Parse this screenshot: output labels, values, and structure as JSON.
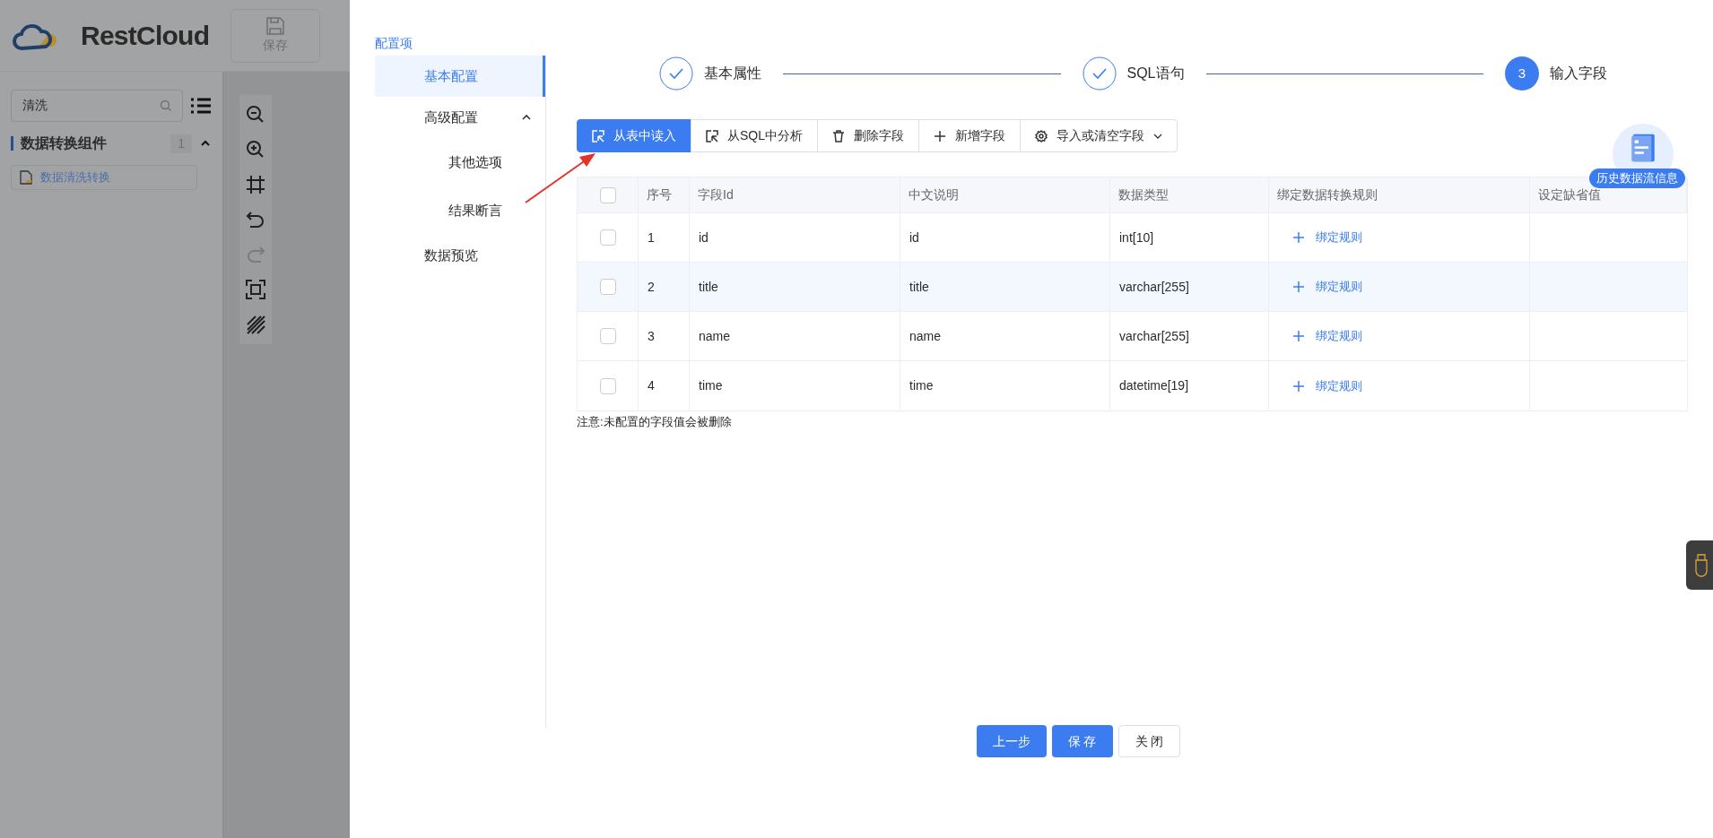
{
  "app": {
    "logo": "RestCloud",
    "toolbar_buttons": [
      {
        "label": "保存"
      }
    ],
    "search": {
      "value": "清洗"
    },
    "category": {
      "title": "数据转换组件",
      "count": "1",
      "expanded": true
    },
    "components": [
      {
        "label": "数据清洗转换"
      }
    ],
    "canvas_tools": [
      {
        "kind": "zoom-out",
        "disabled": false
      },
      {
        "kind": "zoom-in",
        "disabled": false
      },
      {
        "kind": "fit",
        "disabled": false
      },
      {
        "kind": "undo",
        "disabled": false
      },
      {
        "kind": "redo",
        "disabled": true
      },
      {
        "kind": "fullscreen",
        "disabled": false
      },
      {
        "kind": "grid",
        "disabled": false
      }
    ]
  },
  "drawer": {
    "menu_title": "配置项",
    "menu": [
      {
        "label": "基本配置",
        "selected": true
      },
      {
        "label": "高级配置",
        "selected": false,
        "expanded": true,
        "children": [
          {
            "label": "其他选项",
            "selected": false
          },
          {
            "label": "结果断言",
            "selected": false
          }
        ]
      },
      {
        "label": "数据预览",
        "selected": false
      }
    ],
    "steps": [
      {
        "label": "基本属性",
        "kind": "done"
      },
      {
        "label": "SQL语句",
        "kind": "done"
      },
      {
        "label": "输入字段",
        "kind": "current",
        "number": "3"
      }
    ],
    "toolbar": [
      {
        "label": "从表中读入",
        "kind": "select",
        "primary": true
      },
      {
        "label": "从SQL中分析",
        "kind": "select",
        "primary": false
      },
      {
        "label": "删除字段",
        "kind": "trash",
        "primary": false
      },
      {
        "label": "新增字段",
        "kind": "plus",
        "primary": false
      },
      {
        "label": "导入或清空字段",
        "kind": "gear",
        "primary": false,
        "dropdown": true
      }
    ],
    "table": {
      "all_checked": false,
      "columns": [
        "序号",
        "字段Id",
        "中文说明",
        "数据类型",
        "绑定数据转换规则",
        "设定缺省值"
      ],
      "rows": [
        {
          "checked": false,
          "hovered": false,
          "cells": [
            "1",
            "id",
            "id",
            "int[10]"
          ],
          "action": "绑定规则"
        },
        {
          "checked": false,
          "hovered": true,
          "cells": [
            "2",
            "title",
            "title",
            "varchar[255]"
          ],
          "action": "绑定规则"
        },
        {
          "checked": false,
          "hovered": false,
          "cells": [
            "3",
            "name",
            "name",
            "varchar[255]"
          ],
          "action": "绑定规则"
        },
        {
          "checked": false,
          "hovered": false,
          "cells": [
            "4",
            "time",
            "time",
            "datetime[19]"
          ],
          "action": "绑定规则"
        }
      ]
    },
    "note": "注意:未配置的字段值会被删除",
    "footer_buttons": [
      {
        "label": "上一步",
        "primary": true
      },
      {
        "label": "保 存",
        "primary": true
      },
      {
        "label": "关 闭",
        "primary": false
      }
    ],
    "float_badge": "历史数据流信息"
  }
}
